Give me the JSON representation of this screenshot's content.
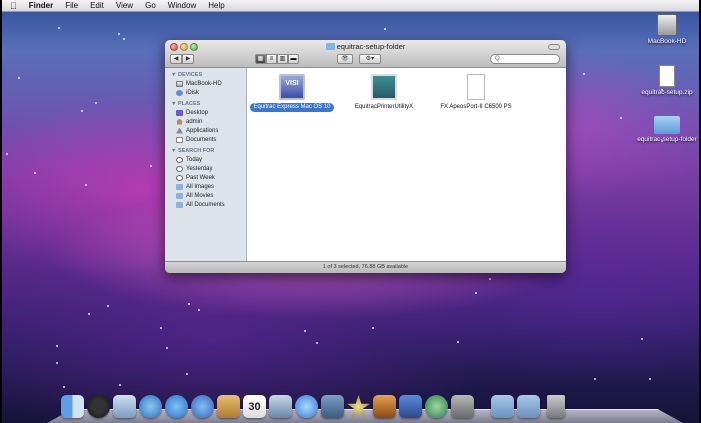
{
  "menubar": {
    "apple": "",
    "app_name": "Finder",
    "items": [
      "File",
      "Edit",
      "View",
      "Go",
      "Window",
      "Help"
    ]
  },
  "finder_window": {
    "title": "equitrac-setup-folder",
    "search_placeholder": "Q",
    "status": "1 of 3 selected, 76.88 GB available",
    "sidebar": {
      "devices_header": "▼ DEVICES",
      "devices": [
        "MacBook-HD",
        "iDisk"
      ],
      "places_header": "▼ PLACES",
      "places": [
        "Desktop",
        "admin",
        "Applications",
        "Documents"
      ],
      "search_header": "▼ SEARCH FOR",
      "search": [
        "Today",
        "Yesterday",
        "Past Week",
        "All Images",
        "All Movies",
        "All Documents"
      ]
    },
    "files": [
      {
        "name": "Equitrac Express Mac OS 10",
        "badge": "VISI",
        "selected": true
      },
      {
        "name": "EquitracPrinterUtilityX",
        "selected": false
      },
      {
        "name": "FX ApeosPort-II C6500  PS",
        "selected": false
      }
    ]
  },
  "desktop_icons": [
    {
      "label": "MacBook-HD",
      "icon": "hard-drive-icon"
    },
    {
      "label": "equitrac-setup.zip",
      "icon": "zip-file-icon"
    },
    {
      "label": "equitrac-setup-folder",
      "icon": "folder-icon"
    }
  ],
  "dock": {
    "calendar_day": "30",
    "apps": [
      "finder-icon",
      "dashboard-icon",
      "mail-icon",
      "safari-icon",
      "ichat-icon",
      "ichat-video-icon",
      "address-book-icon",
      "ical-icon",
      "preview-icon",
      "itunes-icon",
      "iphoto-icon",
      "imovie-icon",
      "garageband-icon",
      "spaces-icon",
      "time-machine-icon",
      "system-preferences-icon",
      "documents-stack-icon",
      "downloads-stack-icon",
      "trash-icon"
    ]
  }
}
